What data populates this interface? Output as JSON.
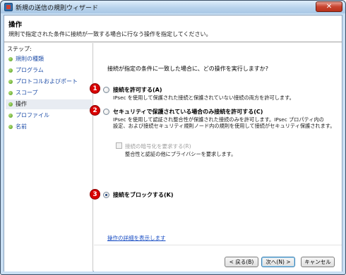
{
  "window": {
    "title": "新規の送信の規則ウィザード",
    "close_glyph": "✕"
  },
  "header": {
    "title": "操作",
    "description": "規則で指定された条件に接続が一致する場合に行なう操作を指定してください。"
  },
  "steps": {
    "title": "ステップ:",
    "items": [
      {
        "label": "規則の種類"
      },
      {
        "label": "プログラム"
      },
      {
        "label": "プロトコルおよびポート"
      },
      {
        "label": "スコープ"
      },
      {
        "label": "操作"
      },
      {
        "label": "プロファイル"
      },
      {
        "label": "名前"
      }
    ],
    "current_index": 4
  },
  "main": {
    "question": "接続が指定の条件に一致した場合に、どの操作を実行しますか?",
    "options": [
      {
        "badge": "1",
        "label": "接続を許可する(A)",
        "desc_lines": [
          "IPsec を使用して保護された接続と保護されていない接続の両方を許可します。"
        ],
        "checked": false
      },
      {
        "badge": "2",
        "label": "セキュリティで保護されている場合のみ接続を許可する(C)",
        "desc_lines": [
          "IPsec を使用して認証され整合性が保護された接続のみを許可します。IPsec プロパティ内の",
          "設定、および接続セキュリティ規則ノード内の規則を使用して接続がセキュリティ保護されます。"
        ],
        "checked": false
      },
      {
        "badge": "3",
        "label": "接続をブロックする(K)",
        "desc_lines": [],
        "checked": true
      }
    ],
    "encryption": {
      "label": "接続の暗号化を要求する(R)",
      "desc": "整合性と認証の他にプライバシーを要求します。",
      "enabled": false
    },
    "details_link": "操作の詳細を表示します"
  },
  "buttons": {
    "back": "< 戻る(B)",
    "next": "次へ(N) >",
    "cancel": "キャンセル"
  },
  "colors": {
    "badge": "#d90000",
    "link": "#1b4fc4",
    "title_bar": "#b8d3ec"
  }
}
